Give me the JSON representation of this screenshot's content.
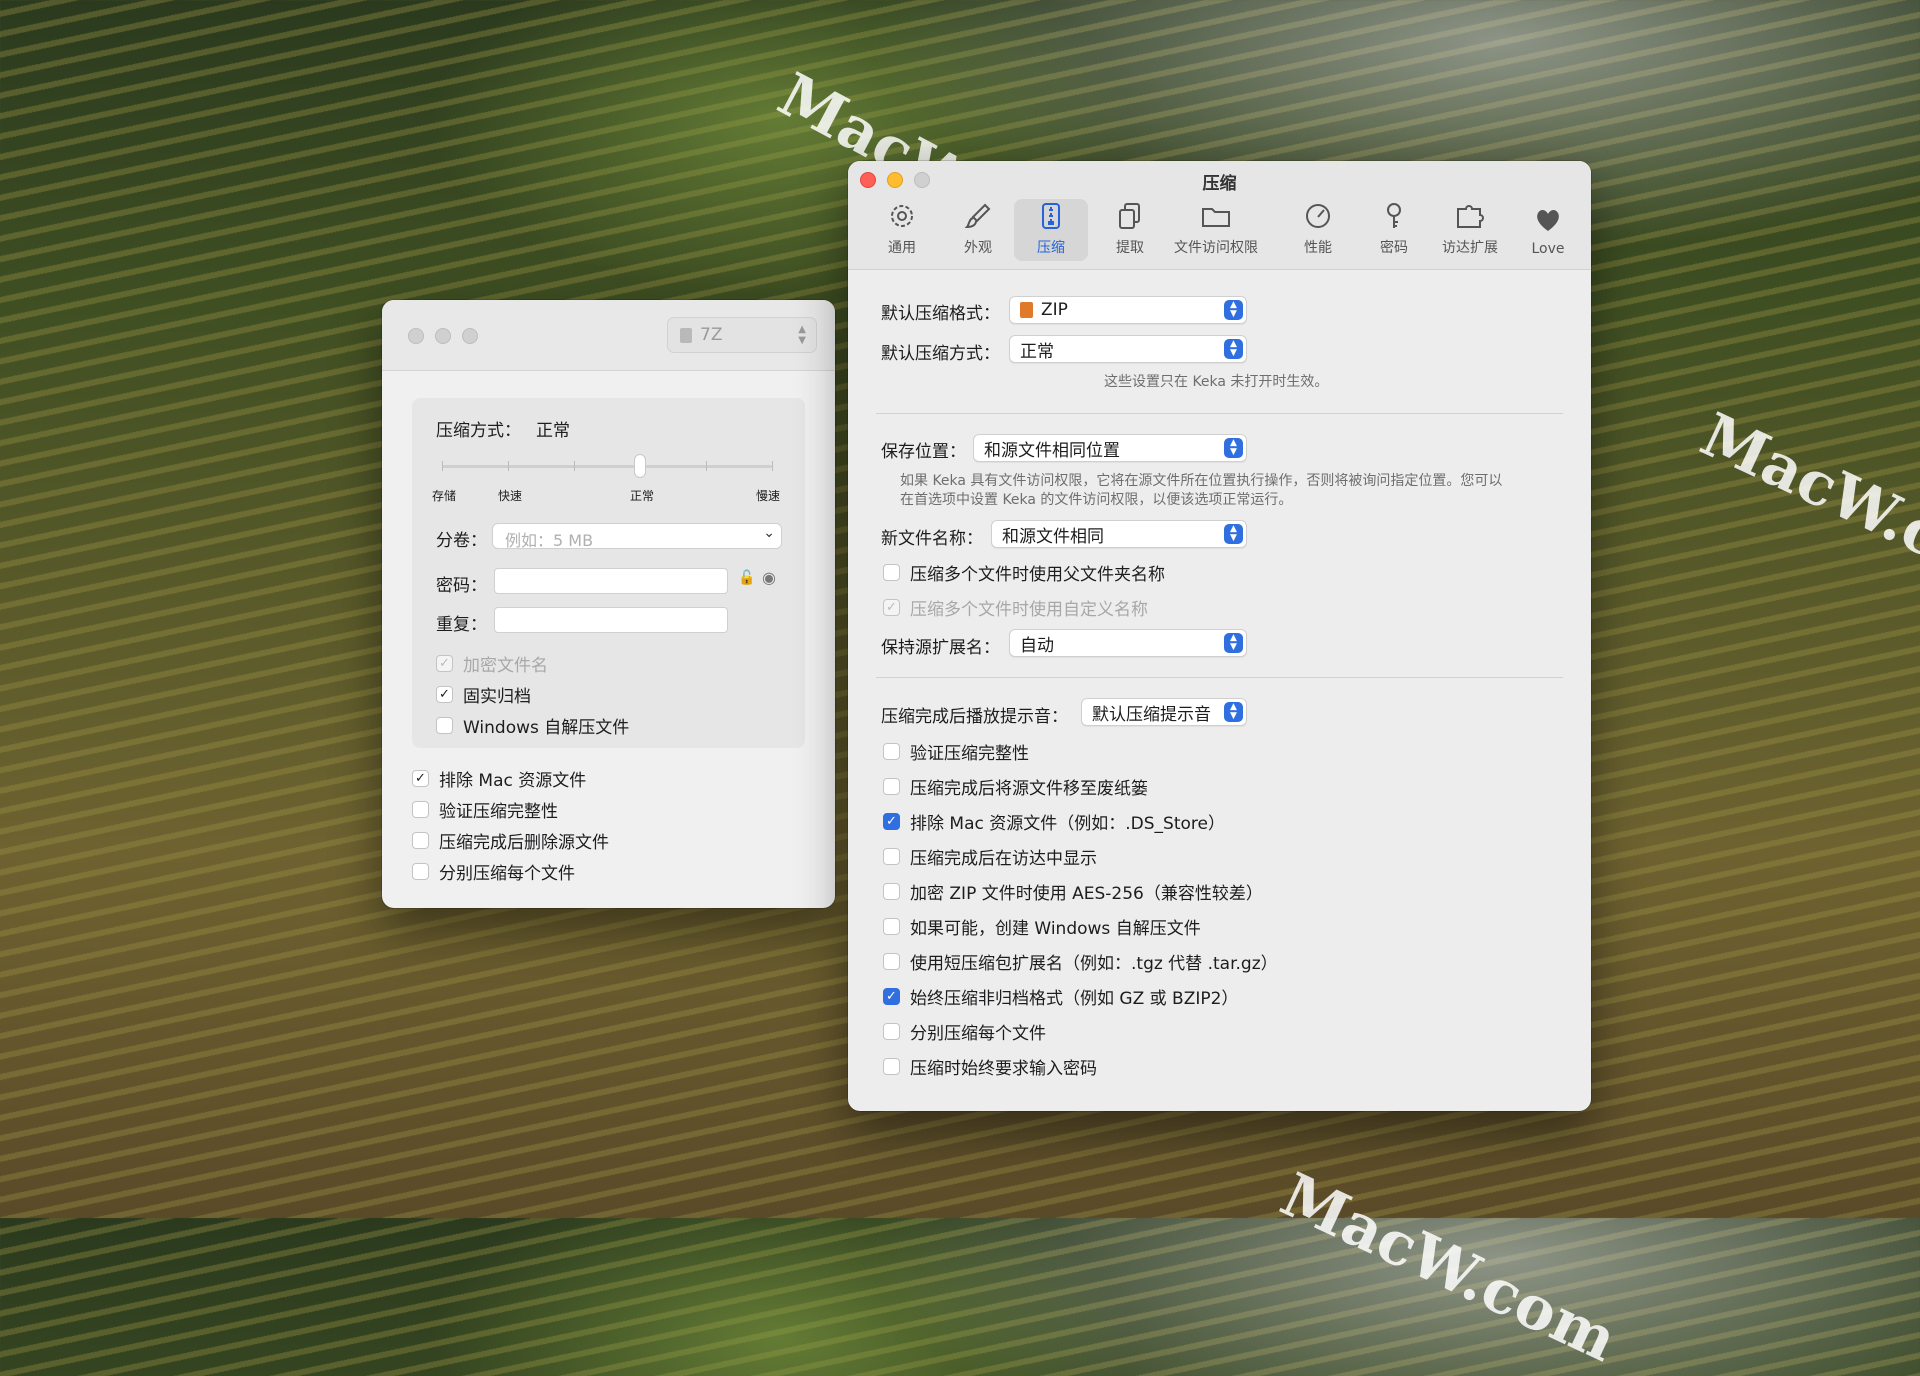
{
  "watermark": "MacW.com",
  "left_window": {
    "format": "7Z",
    "compression_label": "压缩方式：",
    "compression_value": "正常",
    "slider_value_fraction": 0.6,
    "slider_ticks": [
      "存储",
      "快速",
      "正常",
      "慢速"
    ],
    "split_label": "分卷：",
    "split_placeholder": "例如：5 MB",
    "password_label": "密码：",
    "repeat_label": "重复：",
    "options": [
      {
        "label": "加密文件名",
        "checked": true,
        "disabled": true
      },
      {
        "label": "固实归档",
        "checked": true
      },
      {
        "label": "Windows 自解压文件",
        "checked": false
      }
    ],
    "extra_options": [
      {
        "label": "排除 Mac 资源文件",
        "checked": true
      },
      {
        "label": "验证压缩完整性",
        "checked": false
      },
      {
        "label": "压缩完成后删除源文件",
        "checked": false
      },
      {
        "label": "分别压缩每个文件",
        "checked": false
      }
    ]
  },
  "right_window": {
    "title": "压缩",
    "tabs": [
      {
        "label": "通用",
        "icon": "gear-icon"
      },
      {
        "label": "外观",
        "icon": "brush-icon"
      },
      {
        "label": "压缩",
        "icon": "zipper-icon",
        "selected": true
      },
      {
        "label": "提取",
        "icon": "documents-icon"
      },
      {
        "label": "文件访问权限",
        "icon": "folder-icon"
      },
      {
        "label": "性能",
        "icon": "gauge-icon"
      },
      {
        "label": "密码",
        "icon": "key-icon"
      },
      {
        "label": "访达扩展",
        "icon": "puzzle-icon"
      },
      {
        "label": "Love",
        "icon": "heart-icon"
      }
    ],
    "default_format_label": "默认压缩格式：",
    "default_format_value": "ZIP",
    "default_method_label": "默认压缩方式：",
    "default_method_value": "正常",
    "settings_note": "这些设置只在 Keka 未打开时生效。",
    "save_label": "保存位置：",
    "save_value": "和源文件相同位置",
    "save_note_1": "如果 Keka 具有文件访问权限，它将在源文件所在位置执行操作，否则将被询问指定位置。您可以",
    "save_note_2": "在首选项中设置 Keka 的文件访问权限，以便该选项正常运行。",
    "filename_label": "新文件名称：",
    "filename_value": "和源文件相同",
    "cb_parent": "压缩多个文件时使用父文件夹名称",
    "cb_custom": "压缩多个文件时使用自定义名称",
    "keep_ext_label": "保持源扩展名：",
    "keep_ext_value": "自动",
    "sound_label": "压缩完成后播放提示音：",
    "sound_value": "默认压缩提示音",
    "checks": [
      {
        "label": "验证压缩完整性",
        "checked": false
      },
      {
        "label": "压缩完成后将源文件移至废纸篓",
        "checked": false
      },
      {
        "label": "排除 Mac 资源文件（例如：.DS_Store）",
        "checked": true
      },
      {
        "label": "压缩完成后在访达中显示",
        "checked": false
      },
      {
        "label": "加密 ZIP 文件时使用 AES-256（兼容性较差）",
        "checked": false
      },
      {
        "label": "如果可能，创建 Windows 自解压文件",
        "checked": false
      },
      {
        "label": "使用短压缩包扩展名（例如：.tgz 代替 .tar.gz）",
        "checked": false
      },
      {
        "label": "始终压缩非归档格式（例如 GZ 或 BZIP2）",
        "checked": true
      },
      {
        "label": "分别压缩每个文件",
        "checked": false
      },
      {
        "label": "压缩时始终要求输入密码",
        "checked": false
      }
    ]
  }
}
